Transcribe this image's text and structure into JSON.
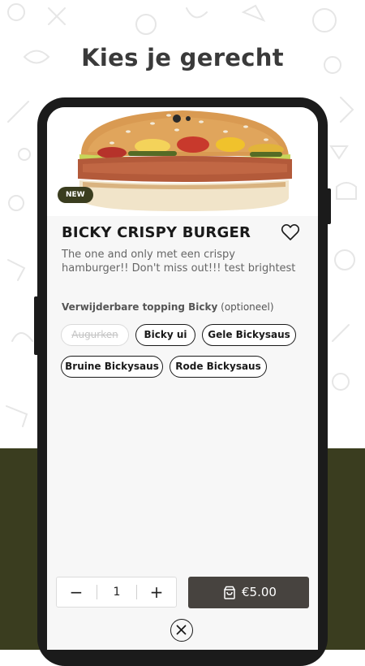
{
  "headline": "Kies je gerecht",
  "product": {
    "badge": "NEW",
    "title": "BICKY CRISPY BURGER",
    "description": "The one and only met een crispy hamburger!! Don't miss out!!! test brightest"
  },
  "toppings": {
    "label_bold": "Verwijderbare topping Bicky",
    "label_optional": "(optioneel)",
    "chips": [
      {
        "label": "Augurken",
        "disabled": true
      },
      {
        "label": "Bicky ui",
        "disabled": false
      },
      {
        "label": "Gele Bickysaus",
        "disabled": false
      },
      {
        "label": "Bruine Bickysaus",
        "disabled": false
      },
      {
        "label": "Rode Bickysaus",
        "disabled": false
      }
    ]
  },
  "quantity": {
    "minus": "−",
    "value": "1",
    "plus": "+"
  },
  "cart": {
    "price": "€5.00",
    "icon": "shopping-bag-icon"
  },
  "icons": {
    "favorite": "heart-icon",
    "close": "close-icon"
  },
  "colors": {
    "brand_dark": "#3a3d1f",
    "cart_button": "#47433f",
    "headline": "#3a3a3a"
  }
}
